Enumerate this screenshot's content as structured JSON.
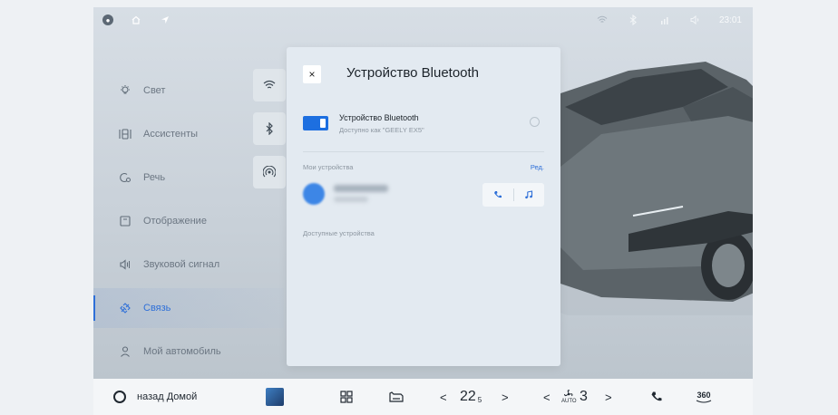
{
  "status_bar": {
    "badge_icon": "user-badge",
    "icons": [
      "home-icon",
      "navigation-arrow-icon"
    ],
    "right_icons": [
      "wifi-icon",
      "bluetooth-icon",
      "cellular-4g-icon",
      "volume-icon"
    ],
    "time": "23:01"
  },
  "menu": {
    "items": [
      {
        "label": "Свет",
        "icon": "light-icon",
        "active": false
      },
      {
        "label": "Ассистенты",
        "icon": "assistant-icon",
        "active": false
      },
      {
        "label": "Речь",
        "icon": "speech-icon",
        "active": false
      },
      {
        "label": "Отображение",
        "icon": "display-icon",
        "active": false
      },
      {
        "label": "Звуковой сигнал",
        "icon": "sound-icon",
        "active": false
      },
      {
        "label": "Связь",
        "icon": "connection-icon",
        "active": true
      },
      {
        "label": "Мой автомобиль",
        "icon": "person-icon",
        "active": false
      }
    ]
  },
  "quick_toggles": [
    "wifi-icon",
    "bluetooth-icon",
    "hotspot-icon"
  ],
  "dialog": {
    "title": "Устройство Bluetooth",
    "close_label": "×",
    "bt_toggle_on": true,
    "bt_name": "Устройство Bluetooth",
    "bt_visible_as": "Доступно как \"GEELY EX5\"",
    "my_devices_label": "Мои устройства",
    "edit_label": "Ред.",
    "available_label": "Доступные устройства",
    "device_actions": [
      "phone-icon",
      "music-icon"
    ]
  },
  "dock": {
    "home_label": "назад Домой",
    "temperature": "22",
    "temperature_decimal": "5",
    "fan_speed": "3",
    "fan_mode": "AUTO",
    "camera_label": "360",
    "prev": "<",
    "next": ">"
  },
  "colors": {
    "accent": "#2e6fd8",
    "dialog_bg": "#e3eaf1",
    "screen_bg": "#d0d8df"
  }
}
